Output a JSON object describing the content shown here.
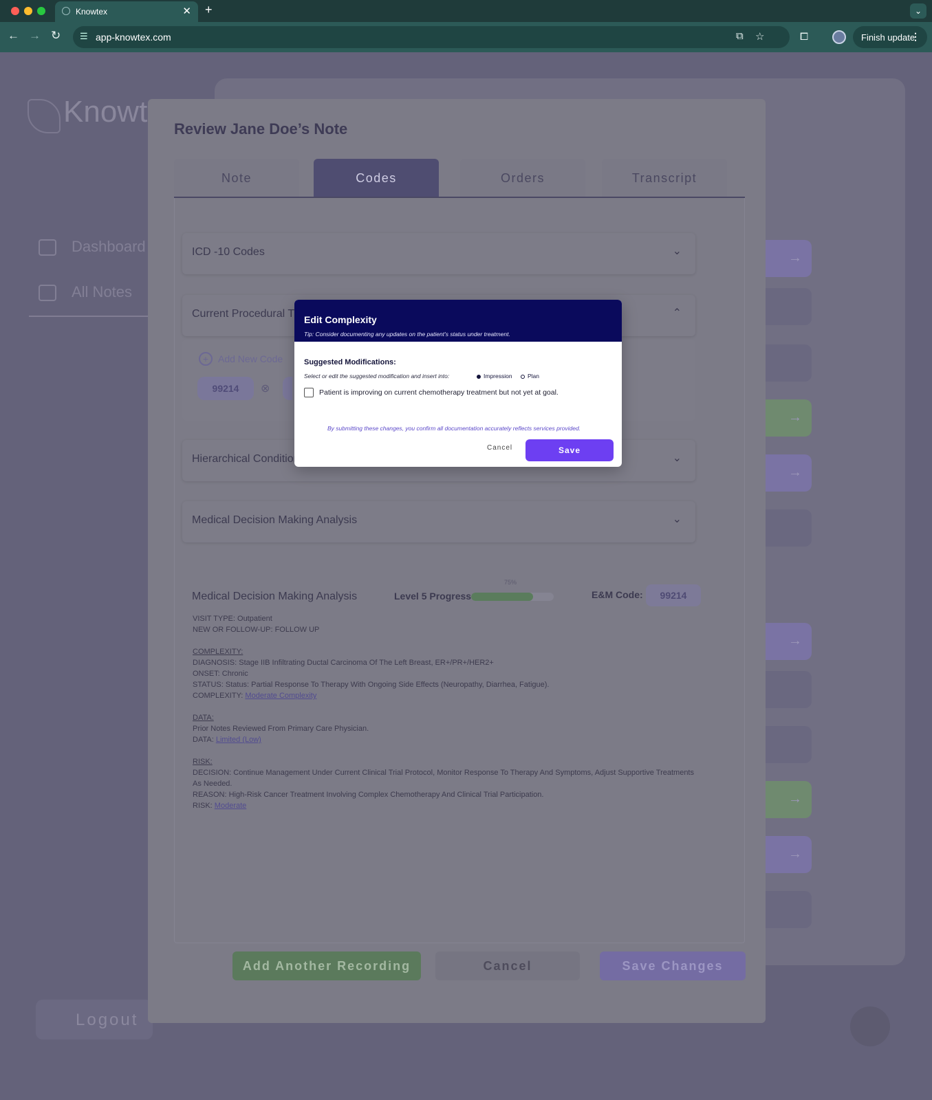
{
  "browser": {
    "tab_title": "Knowtex",
    "new_tab": "+",
    "url": "app-knowtex.com",
    "finish_update": "Finish update",
    "colors": {
      "frame": "#1f3b3a",
      "toolbar": "#2c5a57"
    }
  },
  "background_app": {
    "logo_text": "Knowt",
    "nav": [
      "Dashboard",
      "All Notes"
    ],
    "logout": "Logout"
  },
  "review": {
    "title": "Review Jane Doe’s Note",
    "tabs": [
      "Note",
      "Codes",
      "Orders",
      "Transcript"
    ],
    "active_tab": "Codes",
    "sections": {
      "icd": "ICD -10 Codes",
      "cpt": "Current Procedural T",
      "hcc": "Hierarchical Condition Category (HCC) Codes",
      "mdm": "Medical Decision Making Analysis"
    },
    "add_code": "Add New Code",
    "cpt_code": "99214",
    "mdm": {
      "title": "Medical Decision Making Analysis",
      "progress_label": "Level 5 Progress",
      "progress_value": 0.75,
      "progress_text": "75%",
      "em_label": "E&M Code:",
      "em_code": "99214",
      "visit_type": "VISIT TYPE: Outpatient",
      "new_follow": "NEW OR FOLLOW-UP: FOLLOW UP",
      "complexity_heading": "COMPLEXITY:",
      "diagnosis": "DIAGNOSIS: Stage IIB Infiltrating Ductal Carcinoma Of The Left Breast, ER+/PR+/HER2+",
      "onset": "ONSET: Chronic",
      "status": "STATUS: Status: Partial Response To Therapy With Ongoing Side Effects (Neuropathy, Diarrhea, Fatigue).",
      "complexity_label": "COMPLEXITY: ",
      "complexity_value": "Moderate Complexity",
      "data_heading": "DATA:",
      "data_line": "Prior Notes Reviewed From Primary Care Physician.",
      "data_label": "DATA: ",
      "data_value": "Limited (Low)",
      "risk_heading": "RISK:",
      "decision": "DECISION: Continue Management Under Current Clinical Trial Protocol, Monitor Response To Therapy And Symptoms, Adjust Supportive Treatments As Needed.",
      "reason": "REASON: High-Risk Cancer Treatment Involving Complex Chemotherapy And Clinical Trial Participation.",
      "risk_label": "RISK: ",
      "risk_value": "Moderate"
    },
    "buttons": {
      "add_recording": "Add Another Recording",
      "cancel": "Cancel",
      "save_changes": "Save Changes"
    }
  },
  "dialog": {
    "title": "Edit Complexity",
    "tip": "Tip: Consider documenting any updates on the patient’s status under treatment.",
    "subtitle": "Suggested Modifications:",
    "instruction": "Select or edit the suggested modification and insert into:",
    "insert_options": [
      "Impression",
      "Plan"
    ],
    "selected_option": "Impression",
    "modification": "Patient is improving on current chemotherapy treatment but not yet at goal.",
    "confirm": "By submitting these changes, you confirm all documentation accurately reflects services provided.",
    "cancel": "Cancel",
    "save": "Save",
    "colors": {
      "header": "#0a0a5c",
      "save": "#6d3ff2"
    }
  }
}
